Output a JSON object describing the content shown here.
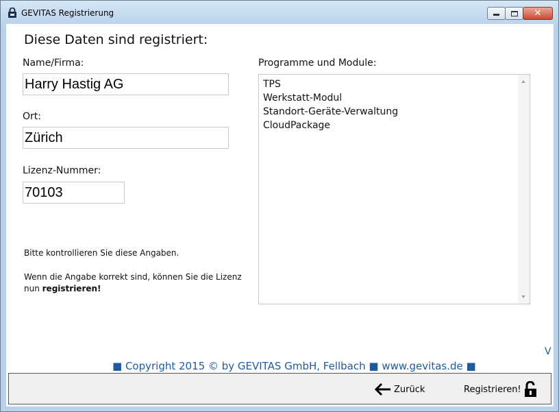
{
  "window": {
    "title": "GEVITAS Registrierung"
  },
  "main": {
    "heading": "Diese Daten sind registriert:",
    "name_label": "Name/Firma:",
    "name_value": "Harry Hastig AG",
    "ort_label": "Ort:",
    "ort_value": "Zürich",
    "license_label": "Lizenz-Nummer:",
    "license_value": "70103",
    "modules_label": "Programme und Module:",
    "modules": [
      "TPS",
      "Werkstatt-Modul",
      "Standort-Geräte-Verwaltung",
      "CloudPackage"
    ],
    "hint1": "Bitte kontrollieren Sie diese Angaben.",
    "hint2": "Wenn die Angabe korrekt sind, können Sie die Lizenz",
    "hint3_prefix": "nun ",
    "hint3_bold": "registrieren!",
    "version": "V",
    "copyright": "■ Copyright 2015 © by GEVITAS GmbH, Fellbach ■ www.gevitas.de ■"
  },
  "footer": {
    "back_label": "Zurück",
    "register_label": "Registrieren!"
  },
  "colors": {
    "accent": "#1f5a9e",
    "titlebar": "#bcd3ea"
  }
}
